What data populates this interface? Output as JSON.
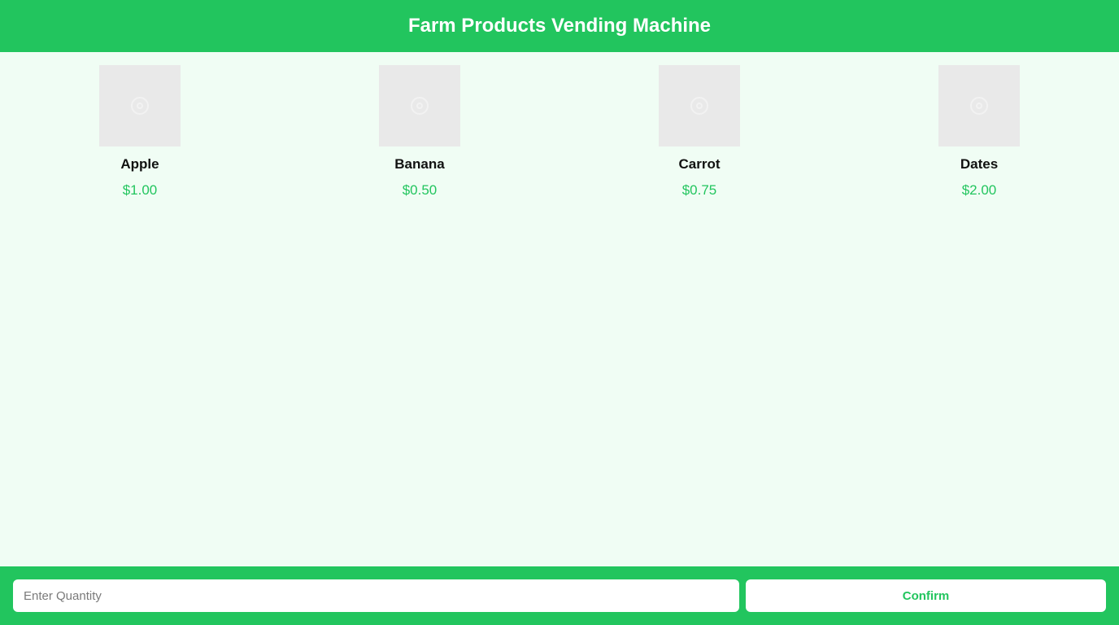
{
  "header": {
    "title": "Farm Products Vending Machine"
  },
  "products": [
    {
      "name": "Apple",
      "price": "$1.00",
      "icon": "image-placeholder-icon"
    },
    {
      "name": "Banana",
      "price": "$0.50",
      "icon": "image-placeholder-icon"
    },
    {
      "name": "Carrot",
      "price": "$0.75",
      "icon": "image-placeholder-icon"
    },
    {
      "name": "Dates",
      "price": "$2.00",
      "icon": "image-placeholder-icon"
    }
  ],
  "footer": {
    "quantity_placeholder": "Enter Quantity",
    "quantity_value": "",
    "confirm_label": "Confirm"
  },
  "colors": {
    "brand": "#22c55e",
    "background": "#f0fdf4",
    "image_placeholder": "#e9e9e9",
    "button_background": "#ffffff"
  }
}
